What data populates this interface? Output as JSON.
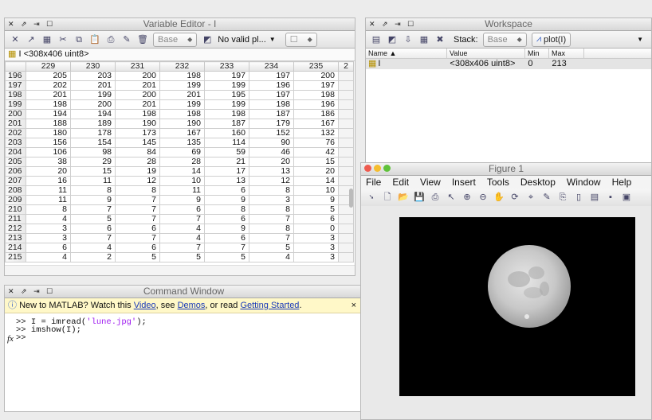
{
  "variable_editor": {
    "title": "Variable Editor - I",
    "toolbar": {
      "base_label": "Base",
      "no_valid_plots": "No valid pl..."
    },
    "var_label": "I <308x406 uint8>",
    "columns": [
      "229",
      "230",
      "231",
      "232",
      "233",
      "234",
      "235",
      "2"
    ],
    "rows": [
      {
        "h": "196",
        "v": [
          "205",
          "203",
          "200",
          "198",
          "197",
          "197",
          "200"
        ]
      },
      {
        "h": "197",
        "v": [
          "202",
          "201",
          "201",
          "199",
          "199",
          "196",
          "197"
        ]
      },
      {
        "h": "198",
        "v": [
          "201",
          "199",
          "200",
          "201",
          "195",
          "197",
          "198"
        ]
      },
      {
        "h": "199",
        "v": [
          "198",
          "200",
          "201",
          "199",
          "199",
          "198",
          "196"
        ]
      },
      {
        "h": "200",
        "v": [
          "194",
          "194",
          "198",
          "198",
          "198",
          "187",
          "186"
        ]
      },
      {
        "h": "201",
        "v": [
          "188",
          "189",
          "190",
          "190",
          "187",
          "179",
          "167"
        ]
      },
      {
        "h": "202",
        "v": [
          "180",
          "178",
          "173",
          "167",
          "160",
          "152",
          "132"
        ]
      },
      {
        "h": "203",
        "v": [
          "156",
          "154",
          "145",
          "135",
          "114",
          "90",
          "76"
        ]
      },
      {
        "h": "204",
        "v": [
          "106",
          "98",
          "84",
          "69",
          "59",
          "46",
          "42"
        ]
      },
      {
        "h": "205",
        "v": [
          "38",
          "29",
          "28",
          "28",
          "21",
          "20",
          "15"
        ]
      },
      {
        "h": "206",
        "v": [
          "20",
          "15",
          "19",
          "14",
          "17",
          "13",
          "20"
        ]
      },
      {
        "h": "207",
        "v": [
          "16",
          "11",
          "12",
          "10",
          "13",
          "12",
          "14"
        ]
      },
      {
        "h": "208",
        "v": [
          "11",
          "8",
          "8",
          "11",
          "6",
          "8",
          "10"
        ]
      },
      {
        "h": "209",
        "v": [
          "11",
          "9",
          "7",
          "9",
          "9",
          "3",
          "9"
        ]
      },
      {
        "h": "210",
        "v": [
          "8",
          "7",
          "7",
          "6",
          "8",
          "8",
          "5"
        ]
      },
      {
        "h": "211",
        "v": [
          "4",
          "5",
          "7",
          "7",
          "6",
          "7",
          "6"
        ]
      },
      {
        "h": "212",
        "v": [
          "3",
          "6",
          "6",
          "4",
          "9",
          "8",
          "0"
        ]
      },
      {
        "h": "213",
        "v": [
          "3",
          "7",
          "7",
          "4",
          "6",
          "7",
          "3"
        ]
      },
      {
        "h": "214",
        "v": [
          "6",
          "4",
          "6",
          "7",
          "7",
          "5",
          "3"
        ]
      },
      {
        "h": "215",
        "v": [
          "4",
          "2",
          "5",
          "5",
          "5",
          "4",
          "3"
        ]
      }
    ]
  },
  "command_window": {
    "title": "Command Window",
    "info_prefix": "New to MATLAB? Watch this ",
    "info_video": "Video",
    "info_mid1": ", see ",
    "info_demos": "Demos",
    "info_mid2": ", or read ",
    "info_started": "Getting Started",
    "info_end": ".",
    "close": "×",
    "line1_prompt": ">> I = imread(",
    "line1_string": "'lune.jpg'",
    "line1_end": ");",
    "line2": ">> imshow(I);",
    "line3": ">>",
    "fx": "fx"
  },
  "workspace": {
    "title": "Workspace",
    "stack_label": "Stack:",
    "stack_value": "Base",
    "plot_label": "plot(I)",
    "headers": {
      "name": "Name ▲",
      "value": "Value",
      "min": "Min",
      "max": "Max"
    },
    "row": {
      "name": "I",
      "value": "<308x406 uint8>",
      "min": "0",
      "max": "213"
    }
  },
  "figure": {
    "title": "Figure 1",
    "menu": [
      "File",
      "Edit",
      "View",
      "Insert",
      "Tools",
      "Desktop",
      "Window",
      "Help"
    ]
  },
  "colors": {
    "info_bar": "#fff8c8",
    "link": "#1838b8",
    "cmd_string": "#a020f0",
    "close_red": "#ee5b4f",
    "min_yellow": "#f5bd2f",
    "max_green": "#5fc23a"
  }
}
